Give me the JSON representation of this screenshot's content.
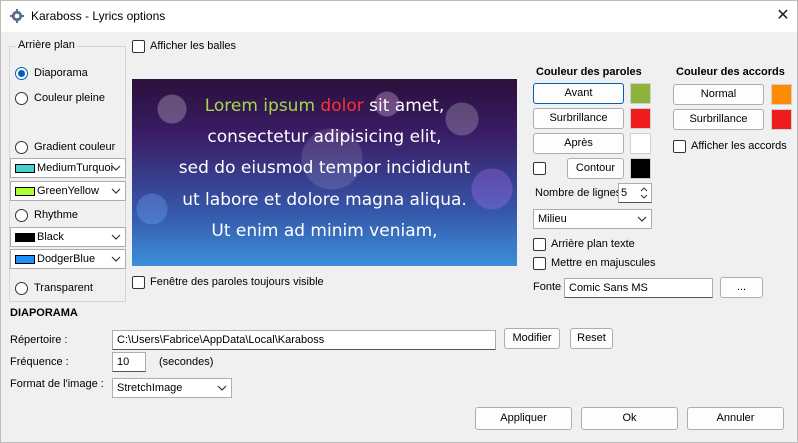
{
  "window": {
    "title": "Karaboss - Lyrics options",
    "close_symbol": "✕"
  },
  "background_group": {
    "label": "Arrière plan",
    "diaporama": "Diaporama",
    "solid_color": "Couleur pleine",
    "gradient": "Gradient couleur",
    "gradient_color1": {
      "name": "MediumTurquoi",
      "color": "#48d1cc"
    },
    "gradient_color2": {
      "name": "GreenYellow",
      "color": "#adff2f"
    },
    "rhythm": "Rhythme",
    "rhythm_color1": {
      "name": "Black",
      "color": "#000000"
    },
    "rhythm_color2": {
      "name": "DodgerBlue",
      "color": "#1e90ff"
    },
    "transparent": "Transparent"
  },
  "show_balls": "Afficher les balles",
  "preview": {
    "line1": [
      "Lorem ipsum ",
      "dolor",
      " sit amet,"
    ],
    "line2": "consectetur adipisicing elit,",
    "line3": "sed do eiusmod tempor incididunt",
    "line4": "ut labore et dolore magna aliqua.",
    "line5": "Ut enim ad minim veniam,",
    "colors": {
      "sung": "#a8d848",
      "current": "#ff3030",
      "rest": "#ffffff"
    }
  },
  "always_visible": "Fenêtre des paroles toujours visible",
  "lyrics_colors": {
    "heading": "Couleur des paroles",
    "before": "Avant",
    "highlight": "Surbrillance",
    "after": "Après",
    "outline": "Contour",
    "before_color": "#8db33a",
    "highlight_color": "#ee1c1c",
    "after_color": "#ffffff",
    "outline_color": "#000000"
  },
  "lines_count": {
    "label": "Nombre de lignes",
    "value": "5"
  },
  "position": {
    "value": "Milieu"
  },
  "text_background": "Arrière plan texte",
  "uppercase": "Mettre en majuscules",
  "font": {
    "label": "Fonte :",
    "value": "Comic Sans MS",
    "browse": "..."
  },
  "chords_colors": {
    "heading": "Couleur des accords",
    "normal": "Normal",
    "highlight": "Surbrillance",
    "normal_color": "#ff8c00",
    "highlight_color": "#ee1c1c",
    "show_chords": "Afficher les accords"
  },
  "slideshow": {
    "heading": "DIAPORAMA",
    "dir_label": "Répertoire :",
    "dir_value": "C:\\Users\\Fabrice\\AppData\\Local\\Karaboss",
    "modify": "Modifier",
    "reset": "Reset",
    "freq_label": "Fréquence :",
    "freq_value": "10",
    "freq_unit": "(secondes)",
    "format_label": "Format de l'image :",
    "format_value": "StretchImage"
  },
  "footer": {
    "apply": "Appliquer",
    "ok": "Ok",
    "cancel": "Annuler"
  }
}
